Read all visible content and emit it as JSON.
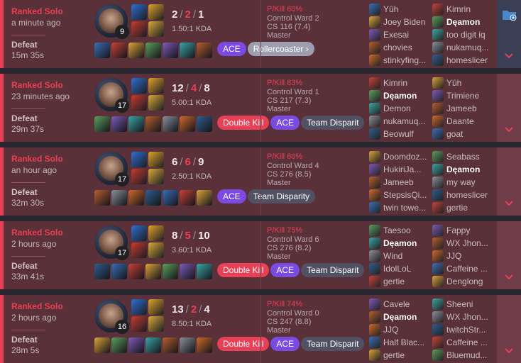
{
  "matches": [
    {
      "queue": "Ranked Solo",
      "time_ago": "a minute ago",
      "result": "Defeat",
      "duration": "15m 35s",
      "level": "9",
      "kills": "2",
      "deaths": "2",
      "assists": "1",
      "kda_ratio": "1.50:1 KDA",
      "tags": [
        {
          "label": "ACE",
          "style": "purple"
        },
        {
          "label": "Rollercoaster ›",
          "style": "light"
        }
      ],
      "pkill": "P/Kill 60%",
      "control_ward": "Control Ward 2",
      "cs": "CS 116 (7.4)",
      "rank": "Master",
      "team1": [
        "Yûh",
        "Joey Biden",
        "Exesai",
        "chovies",
        "stinkyfing..."
      ],
      "team2": [
        "Kimrin",
        "Dęamon",
        "too digit iq",
        "nukamuq...",
        "homeslicer"
      ],
      "me_team": 2,
      "me_index": 1,
      "side_icon": "folder-plus-icon"
    },
    {
      "queue": "Ranked Solo",
      "time_ago": "23 minutes ago",
      "result": "Defeat",
      "duration": "29m 37s",
      "level": "17",
      "kills": "12",
      "deaths": "4",
      "assists": "8",
      "kda_ratio": "5.00:1 KDA",
      "tags": [
        {
          "label": "Double Kill",
          "style": "red"
        },
        {
          "label": "ACE",
          "style": "purple"
        },
        {
          "label": "Team Disparit",
          "style": "grey"
        }
      ],
      "pkill": "P/Kill 83%",
      "control_ward": "Control Ward 1",
      "cs": "CS 217 (7.3)",
      "rank": "Master",
      "team1": [
        "Kimrin",
        "Dęamon",
        "Demon",
        "nukamuq...",
        "Beowulf"
      ],
      "team2": [
        "Yûh",
        "Trimiene",
        "Jameeb",
        "Daante",
        "goat"
      ],
      "me_team": 1,
      "me_index": 1
    },
    {
      "queue": "Ranked Solo",
      "time_ago": "an hour ago",
      "result": "Defeat",
      "duration": "32m 30s",
      "level": "17",
      "kills": "6",
      "deaths": "6",
      "assists": "9",
      "kda_ratio": "2.50:1 KDA",
      "tags": [
        {
          "label": "ACE",
          "style": "purple"
        },
        {
          "label": "Team Disparity",
          "style": "grey"
        }
      ],
      "pkill": "P/Kill 60%",
      "control_ward": "Control Ward 4",
      "cs": "CS 276 (8.5)",
      "rank": "Master",
      "team1": [
        "Doomdoz...",
        "HukiriJa...",
        "Jameeb",
        "StepsisQi...",
        "twin towe..."
      ],
      "team2": [
        "Seabass",
        "Dęamon",
        "my way",
        "homeslicer",
        "gertie"
      ],
      "me_team": 2,
      "me_index": 1
    },
    {
      "queue": "Ranked Solo",
      "time_ago": "2 hours ago",
      "result": "Defeat",
      "duration": "33m 41s",
      "level": "17",
      "kills": "8",
      "deaths": "5",
      "assists": "10",
      "kda_ratio": "3.60:1 KDA",
      "tags": [
        {
          "label": "Double Kill",
          "style": "red"
        },
        {
          "label": "ACE",
          "style": "purple"
        },
        {
          "label": "Team Disparit",
          "style": "grey"
        }
      ],
      "pkill": "P/Kill 75%",
      "control_ward": "Control Ward 6",
      "cs": "CS 276 (8.2)",
      "rank": "Master",
      "team1": [
        "Taesoo",
        "Dęamon",
        "Wind",
        "IdolLoL",
        "gertie"
      ],
      "team2": [
        "Fappy",
        "WX Jhon...",
        "JJQ",
        "Caffeine ...",
        "Denglong"
      ],
      "me_team": 1,
      "me_index": 1
    },
    {
      "queue": "Ranked Solo",
      "time_ago": "2 hours ago",
      "result": "Defeat",
      "duration": "28m 5s",
      "level": "16",
      "kills": "13",
      "deaths": "2",
      "assists": "4",
      "kda_ratio": "8.50:1 KDA",
      "tags": [
        {
          "label": "Double Kill",
          "style": "red"
        },
        {
          "label": "ACE",
          "style": "purple"
        },
        {
          "label": "Team Disparit",
          "style": "grey"
        }
      ],
      "pkill": "P/Kill 74%",
      "control_ward": "Control Ward 0",
      "cs": "CS 247 (8.8)",
      "rank": "Master",
      "team1": [
        "Cavele",
        "Dęamon",
        "JJQ",
        "Half Blac...",
        "gertie"
      ],
      "team2": [
        "Sheeni",
        "WX Jhon...",
        "twitchStr...",
        "Caffeine ...",
        "Bluemud..."
      ],
      "me_team": 1,
      "me_index": 1
    }
  ],
  "colors": {
    "defeat_bg": "#5a3039",
    "accent": "#e84057",
    "side_bg": "#703c48",
    "ace": "#7b4ae2"
  },
  "icons": {
    "expand": "chevron-down-icon"
  }
}
